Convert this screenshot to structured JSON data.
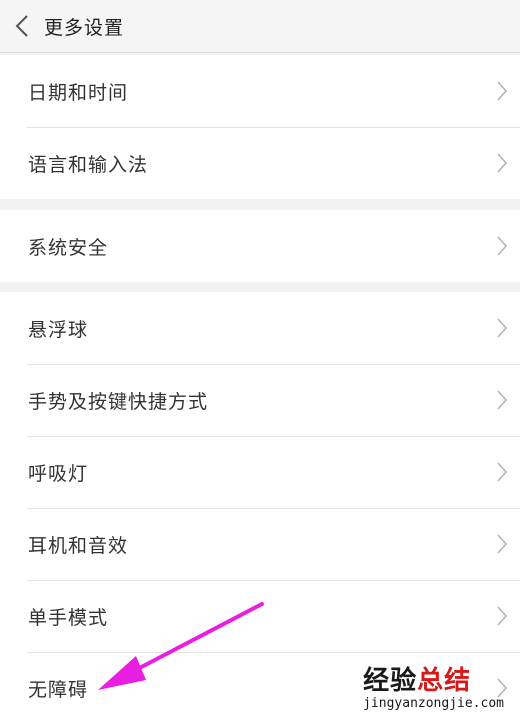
{
  "header": {
    "title": "更多设置",
    "back_icon": "chevron-left-icon"
  },
  "groups": [
    {
      "items": [
        {
          "label": "日期和时间"
        },
        {
          "label": "语言和输入法"
        }
      ]
    },
    {
      "items": [
        {
          "label": "系统安全"
        }
      ]
    },
    {
      "items": [
        {
          "label": "悬浮球"
        },
        {
          "label": "手势及按键快捷方式"
        },
        {
          "label": "呼吸灯"
        },
        {
          "label": "耳机和音效"
        },
        {
          "label": "单手模式"
        },
        {
          "label": "无障碍"
        }
      ]
    }
  ],
  "watermark": {
    "brand_black": "经验",
    "brand_red": "总结",
    "url": "jingyanzongjie.com"
  },
  "colors": {
    "background": "#f2f2f2",
    "row_background": "#ffffff",
    "arrow": "#e81ee0",
    "brand_red": "#d71818"
  }
}
